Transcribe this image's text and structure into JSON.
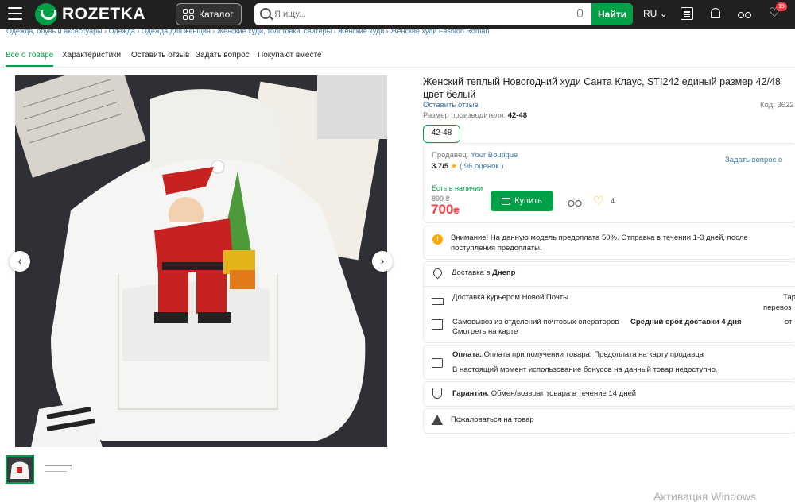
{
  "header": {
    "logo_text": "ROZETKA",
    "catalog_label": "Каталог",
    "search_placeholder": "Я ищу...",
    "search_button": "Найти",
    "lang": "RU",
    "favorites_count": "15"
  },
  "breadcrumbs": "Одежда, обувь и аксессуары › Одежда › Одежда для женщин › Женские худи, толстовки, свитеры › Женские худи › Женские худи Fashion Roman",
  "tabs": [
    {
      "label": "Все о товаре",
      "active": true
    },
    {
      "label": "Характеристики"
    },
    {
      "label": "Оставить отзыв"
    },
    {
      "label": "Задать вопрос"
    },
    {
      "label": "Покупают вместе"
    }
  ],
  "product": {
    "title": "Женский теплый Новогодний худи Санта Клаус, STI242 единый размер 42/48 цвет белый",
    "leave_review": "Оставить отзыв",
    "code_label": "Код:",
    "code_value": "3622",
    "manufacturer_size_label": "Размер производителя:",
    "manufacturer_size_value": "42-48",
    "size_option": "42-48",
    "seller_label": "Продавец:",
    "seller_name": "Your Boutique",
    "ask_seller": "Задать вопрос о",
    "rating": "3.7/5",
    "reviews": "( 96 оценок )",
    "availability": "Есть в наличии",
    "old_price": "899 ₴",
    "price": "700",
    "currency": "₴",
    "buy_label": "Купить",
    "wish_count": "4"
  },
  "notice": "Внимание! На данную модель предоплата 50%. Отправка в течении 1-3 дней, после поступления предоплаты.",
  "delivery": {
    "city_prefix": "Доставка в",
    "city": "Днепр",
    "courier": "Доставка курьером Новой Почты",
    "courier_right_1": "Тар",
    "courier_right_2": "перевоз",
    "pickup": "Самовывоз из отделений почтовых операторов",
    "pickup_time_label": "Средний срок доставки 4 дня",
    "pickup_right": "от",
    "map_link": "Смотреть на карте"
  },
  "payment": {
    "label": "Оплата.",
    "text": "Оплата при получении товара. Предоплата на карту продавца",
    "bonus_note": "В настоящий момент использование бонусов на данный товар недоступно."
  },
  "guarantee": {
    "label": "Гарантия.",
    "text": "Обмен/возврат товара в течение 14 дней"
  },
  "complain": "Пожаловаться на товар",
  "watermark": "Активация Windows",
  "colors": {
    "accent": "#00a046",
    "price": "#f84147",
    "link": "#3e77aa",
    "header": "#221f1f"
  }
}
